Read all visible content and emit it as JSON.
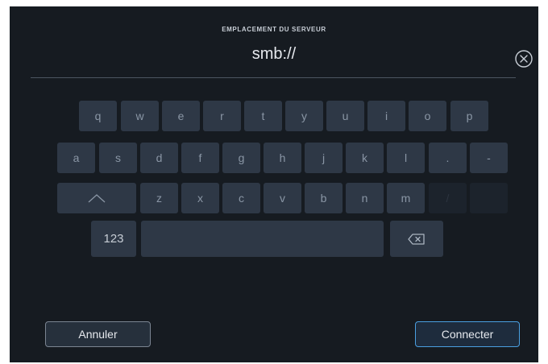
{
  "dialog": {
    "title": "EMPLACEMENT DU SERVEUR",
    "field_value": "smb://",
    "clear_icon": "circle-x-icon"
  },
  "keyboard": {
    "row1": [
      "q",
      "w",
      "e",
      "r",
      "t",
      "y",
      "u",
      "i",
      "o",
      "p"
    ],
    "row2": [
      "a",
      "s",
      "d",
      "f",
      "g",
      "h",
      "j",
      "k",
      "l",
      ".",
      "-"
    ],
    "row3_shift_icon": "chevron-up-icon",
    "row3": [
      "z",
      "x",
      "c",
      "v",
      "b",
      "n",
      "m",
      "/",
      ""
    ],
    "numbers_label": "123",
    "space_label": "",
    "backspace_icon": "backspace-icon"
  },
  "actions": {
    "cancel_label": "Annuler",
    "connect_label": "Connecter"
  },
  "colors": {
    "background": "#161b21",
    "key": "#2e3846",
    "accent": "#4a9fe0"
  }
}
